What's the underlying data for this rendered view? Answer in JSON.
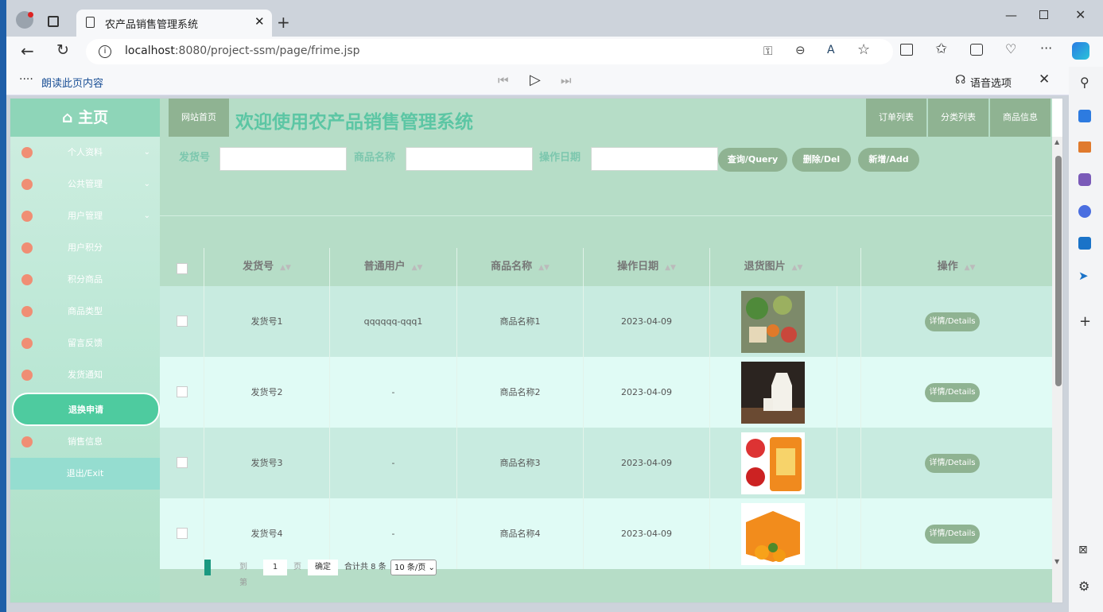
{
  "browser": {
    "tab_title": "农产品销售管理系统",
    "url_host": "localhost",
    "url_rest": ":8080/project-ssm/page/frime.jsp",
    "read_aloud": "朗读此页内容",
    "voice_options": "语音选项"
  },
  "sidebar": {
    "home": "主页",
    "items": [
      {
        "label": "个人资料",
        "expand": true
      },
      {
        "label": "公共管理",
        "expand": true
      },
      {
        "label": "用户管理",
        "expand": true
      },
      {
        "label": "用户积分",
        "expand": false
      },
      {
        "label": "积分商品",
        "expand": false
      },
      {
        "label": "商品类型",
        "expand": false
      },
      {
        "label": "留言反馈",
        "expand": false
      },
      {
        "label": "发货通知",
        "expand": false
      }
    ],
    "active": "退换申请",
    "sales": "销售信息",
    "exit": "退出/Exit"
  },
  "header": {
    "site_home": "网站首页",
    "title": "欢迎使用农产品销售管理系统",
    "nav": [
      "订单列表",
      "分类列表",
      "商品信息"
    ]
  },
  "search": {
    "fields": [
      "发货号",
      "商品名称",
      "操作日期"
    ],
    "query": "查询/Query",
    "del": "删除/Del",
    "add": "新增/Add"
  },
  "table": {
    "headers": [
      "发货号",
      "普通用户",
      "商品名称",
      "操作日期",
      "退货图片",
      "操作"
    ],
    "rows": [
      {
        "ship": "发货号1",
        "user": "qqqqqq-qqq1",
        "product": "商品名称1",
        "date": "2023-04-09",
        "image": "vegetables-photo"
      },
      {
        "ship": "发货号2",
        "user": "-",
        "product": "商品名称2",
        "date": "2023-04-09",
        "image": "milk-photo"
      },
      {
        "ship": "发货号3",
        "user": "-",
        "product": "商品名称3",
        "date": "2023-04-09",
        "image": "rice-bag-photo"
      },
      {
        "ship": "发货号4",
        "user": "-",
        "product": "商品名称4",
        "date": "2023-04-09",
        "image": "orange-box-photo"
      }
    ],
    "details": "详情/Details"
  },
  "pager": {
    "goto": "到第",
    "page_value": "1",
    "page_unit": "页",
    "confirm": "确定",
    "total": "合计共 8 条",
    "per_page": "10 条/页"
  }
}
